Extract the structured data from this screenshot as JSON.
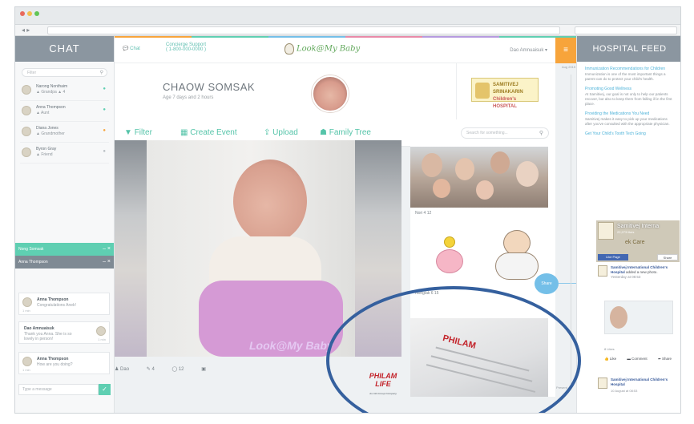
{
  "browser": {
    "nav_back": "◂ ▸",
    "url": "",
    "window_dots": [
      "#e86a5c",
      "#f3bf4e",
      "#62c556"
    ]
  },
  "colors": {
    "teal": "#5fcfb2",
    "orange": "#f7a43b",
    "header_gray": "#8b96a0",
    "strip": [
      "#f7a43b",
      "#5fcfb2",
      "#74bfe8",
      "#e98aa8",
      "#b69adf",
      "#5fcfb2"
    ]
  },
  "chat": {
    "title": "CHAT",
    "search_placeholder": "Filter",
    "contacts": [
      {
        "name": "Narong Nonthaim",
        "sub": "▲ Grandpa ▲ 4",
        "status_color": "#5fcfb2"
      },
      {
        "name": "Anna Thompson",
        "sub": "▲ Aunt",
        "status_color": "#5fcfb2"
      },
      {
        "name": "Diana Jones",
        "sub": "▲ Grandmother",
        "status_color": "#f7a43b"
      },
      {
        "name": "Byron Gray",
        "sub": "▲ Friend",
        "status_color": "#b8bec3"
      }
    ],
    "bar1": "Nong Somsak",
    "bar2": "Anna Thompson",
    "messages": [
      {
        "name": "Anna Thompson",
        "text": "Congratulations Anek!",
        "time": "1 min"
      },
      {
        "name": "Dao Amnuaisuk",
        "text": "Thank you Anna. She is so lovely in person!",
        "time": "1 min"
      },
      {
        "name": "Anna Thompson",
        "text": "How are you doing?",
        "time": "1 min"
      }
    ],
    "input_placeholder": "Type a message",
    "send_icon": "✓"
  },
  "topnav": {
    "chat_label": "Chat",
    "concierge_label": "Concierge Support",
    "concierge_sub": "( 1-800-000-0000 )",
    "logo": "Look@My Baby",
    "user": "Dao Amnuaisuk ▾",
    "menu_icon": "≡"
  },
  "profile": {
    "name": "CHAOW SOMSAK",
    "age": "Age 7 days and 2 hours"
  },
  "hospital": {
    "name_line1": "SAMITIVEJ SRINAKARIN",
    "name_line2": "Children's",
    "name_line3": "HOSPITAL"
  },
  "actionbar": {
    "filter": "Filter",
    "create_event": "Create Event",
    "upload": "Upload",
    "family_tree": "Family Tree",
    "search_placeholder": "Search for something..."
  },
  "photo": {
    "watermark": "Look@My Baby",
    "meta": {
      "author": "Dao",
      "likes": "4",
      "comments": "12",
      "image_icon": "▣"
    }
  },
  "col2": {
    "family_meta": "Nori  4  12",
    "mid_meta": "Nonglak  6  15",
    "share_bubble": "Share"
  },
  "philam": {
    "name": "PHILAM",
    "sub": "LIFE",
    "tagline": "An AIA Group Company"
  },
  "timeline": {
    "top": "Aug 2015",
    "bottom": "Present"
  },
  "feed": {
    "title": "HOSPITAL FEED",
    "items": [
      {
        "title": "Immunization Recommendations for Children",
        "text": "Immunization is one of the most important things a parent can do to protect your child's health."
      },
      {
        "title": "Promoting Good Wellness",
        "text": "At Samitivej, our goal is not only to help our patients recover, but also to keep them from falling ill in the first place."
      },
      {
        "title": "Providing the Medications You Need",
        "text": "Samitivej makes it easy to pick up your medications after you've consulted with the appropriate physician."
      },
      {
        "title": "Get Your Child's Tooth Tech Going",
        "text": ""
      }
    ],
    "fb_page_name": "Samitivej Interna",
    "fb_page_likes": "22,273 likes",
    "fb_care": "ek Care",
    "fb_like_page": "Like Page",
    "fb_share": "Share",
    "fb_post_author": "Samitivej International Children's Hospital",
    "fb_post_text": "added a new photo.",
    "fb_post_date": "Yesterday at 08:53",
    "fb_stats": "8 Likes",
    "fb_actions": {
      "like": "Like",
      "comment": "Comment",
      "share": "Share"
    },
    "fb_post2_author": "Samitivej International Children's Hospital",
    "fb_post2_date": "10 August at 08:53"
  }
}
